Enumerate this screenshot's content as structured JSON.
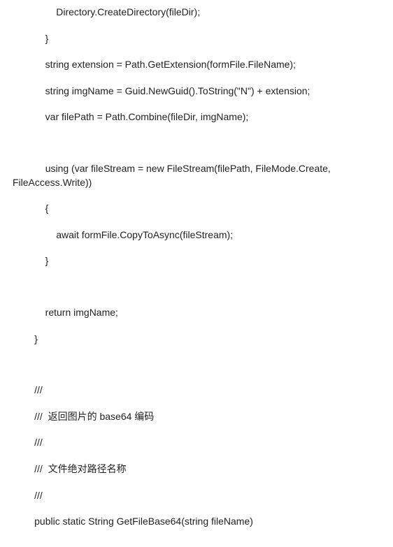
{
  "code": {
    "lines": [
      "                Directory.CreateDirectory(fileDir);",
      "            }",
      "            string extension = Path.GetExtension(formFile.FileName);",
      "            string imgName = Guid.NewGuid().ToString(\"N\") + extension;",
      "            var filePath = Path.Combine(fileDir, imgName);",
      "",
      "            using (var fileStream = new FileStream(filePath, FileMode.Create, FileAccess.Write))",
      "            {",
      "                await formFile.CopyToAsync(fileStream);",
      "            }",
      "",
      "            return imgName;",
      "        }",
      "",
      "        /// ",
      "        ///  返回图片的 base64 编码",
      "        /// ",
      "        ///  文件绝对路径名称",
      "        /// ",
      "        public static String GetFileBase64(string fileName)"
    ]
  }
}
